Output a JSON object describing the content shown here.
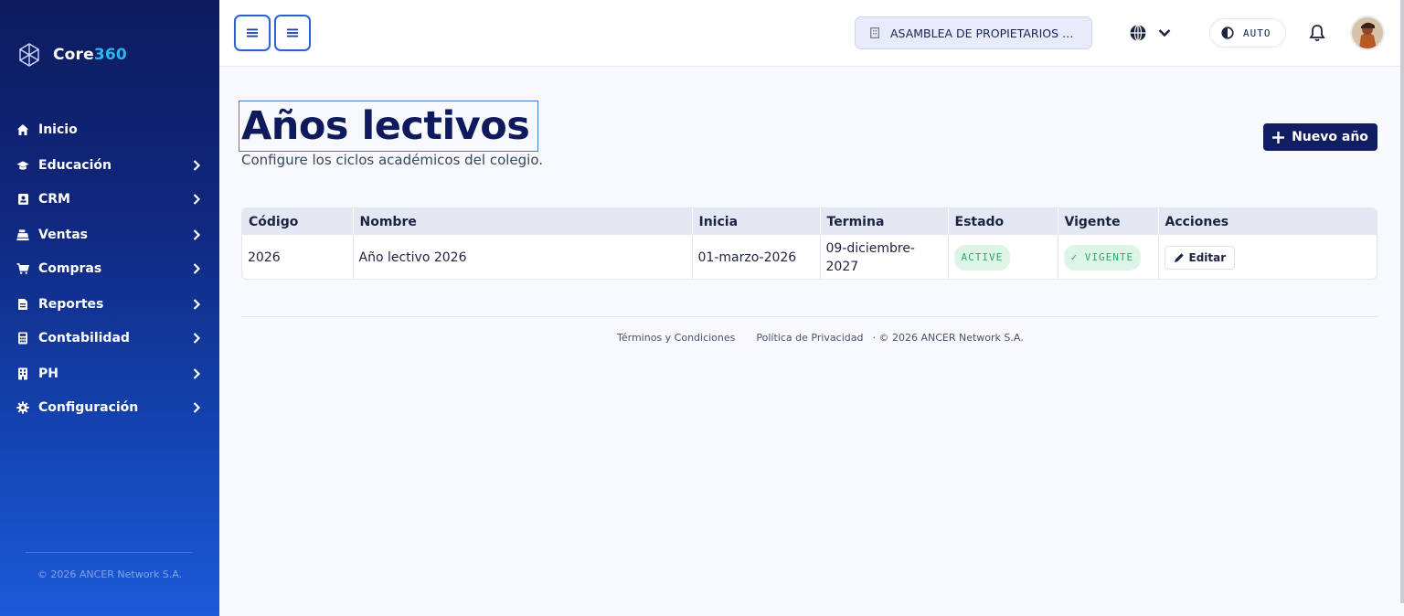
{
  "brand": {
    "name_a": "Core",
    "name_b": "360"
  },
  "sidebar": {
    "items": [
      {
        "label": "Inicio",
        "icon": "home-icon",
        "expandable": false
      },
      {
        "label": "Educación",
        "icon": "graduation-cap-icon",
        "expandable": true
      },
      {
        "label": "CRM",
        "icon": "contact-card-icon",
        "expandable": true
      },
      {
        "label": "Ventas",
        "icon": "cash-register-icon",
        "expandable": true
      },
      {
        "label": "Compras",
        "icon": "shopping-cart-icon",
        "expandable": true
      },
      {
        "label": "Reportes",
        "icon": "report-file-icon",
        "expandable": true
      },
      {
        "label": "Contabilidad",
        "icon": "calculator-icon",
        "expandable": true
      },
      {
        "label": "PH",
        "icon": "building-icon",
        "expandable": true
      },
      {
        "label": "Configuración",
        "icon": "gear-icon",
        "expandable": true
      }
    ],
    "footer": "© 2026 ANCER Network S.A."
  },
  "topbar": {
    "organization": "ASAMBLEA DE PROPIETARIOS DE ...",
    "theme_label": "AUTO"
  },
  "page": {
    "title": "Años lectivos",
    "subtitle": "Configure los ciclos académicos del colegio.",
    "new_button": "Nuevo año"
  },
  "table": {
    "headers": [
      "Código",
      "Nombre",
      "Inicia",
      "Termina",
      "Estado",
      "Vigente",
      "Acciones"
    ],
    "rows": [
      {
        "codigo": "2026",
        "nombre": "Año lectivo 2026",
        "inicia": "01-marzo-2026",
        "termina": "09-diciembre-2027",
        "estado": "ACTIVE",
        "vigente": "✓ VIGENTE",
        "accion": "Editar"
      }
    ]
  },
  "footer": {
    "terms": "Términos y Condiciones",
    "privacy": "Política de Privacidad",
    "copyright": "· © 2026 ANCER Network S.A."
  },
  "colors": {
    "sidebar_top": "#0d1c5e",
    "sidebar_bottom": "#1d5ad8",
    "primary": "#101d63",
    "accent": "#2fb4f0",
    "success": "#2ea86a"
  }
}
